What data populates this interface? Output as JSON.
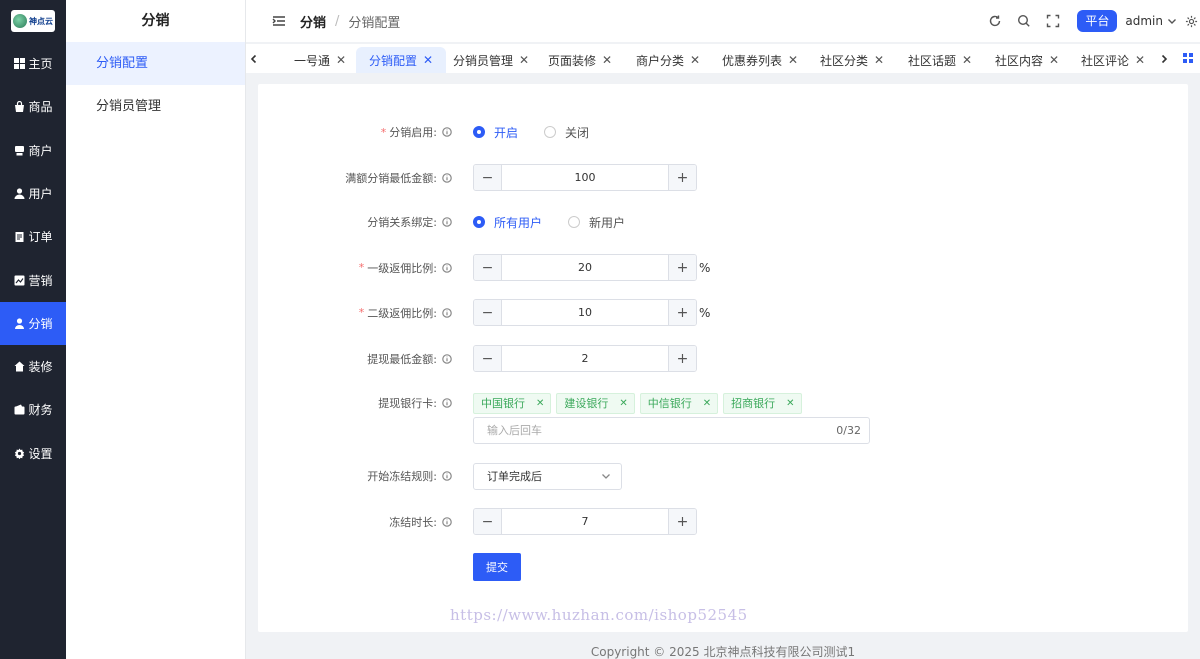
{
  "nav": {
    "logo_text": "神点云",
    "items": [
      {
        "label": "主页",
        "icon": "grid-icon"
      },
      {
        "label": "商品",
        "icon": "bag-icon"
      },
      {
        "label": "商户",
        "icon": "shop-icon"
      },
      {
        "label": "用户",
        "icon": "user-icon"
      },
      {
        "label": "订单",
        "icon": "order-icon"
      },
      {
        "label": "营销",
        "icon": "marketing-icon"
      },
      {
        "label": "分销",
        "icon": "distribution-icon",
        "active": true
      },
      {
        "label": "装修",
        "icon": "home-icon"
      },
      {
        "label": "财务",
        "icon": "wallet-icon"
      },
      {
        "label": "设置",
        "icon": "gear-icon"
      }
    ]
  },
  "submenu": {
    "title": "分销",
    "items": [
      "分销配置",
      "分销员管理"
    ],
    "active_index": 0
  },
  "header": {
    "breadcrumb_main": "分销",
    "breadcrumb_sep": "/",
    "breadcrumb_sub": "分销配置",
    "platform_label": "平台",
    "user_name": "admin"
  },
  "tabs": [
    {
      "label": "一号通"
    },
    {
      "label": "分销配置",
      "active": true
    },
    {
      "label": "分销员管理"
    },
    {
      "label": "页面装修"
    },
    {
      "label": "商户分类"
    },
    {
      "label": "优惠券列表"
    },
    {
      "label": "社区分类"
    },
    {
      "label": "社区话题"
    },
    {
      "label": "社区内容"
    },
    {
      "label": "社区评论"
    }
  ],
  "form": {
    "enable": {
      "label": "分销启用:",
      "required": true,
      "options": [
        "开启",
        "关闭"
      ],
      "selected": 0
    },
    "min_amount": {
      "label": "满额分销最低金额:",
      "value": "100"
    },
    "binding": {
      "label": "分销关系绑定:",
      "options": [
        "所有用户",
        "新用户"
      ],
      "selected": 0
    },
    "level1": {
      "label": "一级返佣比例:",
      "required": true,
      "value": "20",
      "unit": "%"
    },
    "level2": {
      "label": "二级返佣比例:",
      "required": true,
      "value": "10",
      "unit": "%"
    },
    "withdraw_min": {
      "label": "提现最低金额:",
      "value": "2"
    },
    "bank_cards": {
      "label": "提现银行卡:",
      "tags": [
        "中国银行",
        "建设银行",
        "中信银行",
        "招商银行"
      ],
      "placeholder": "输入后回车",
      "counter": "0/32"
    },
    "freeze_rule": {
      "label": "开始冻结规则:",
      "value": "订单完成后"
    },
    "freeze_days": {
      "label": "冻结时长:",
      "value": "7"
    },
    "submit_label": "提交"
  },
  "watermark": "https://www.huzhan.com/ishop52545",
  "footer": "Copyright © 2025 北京神点科技有限公司测试1",
  "colors": {
    "primary": "#2d5cf6",
    "nav_bg": "#1f2430",
    "tag_green": "#3aa85a",
    "required": "#f56c6c"
  }
}
